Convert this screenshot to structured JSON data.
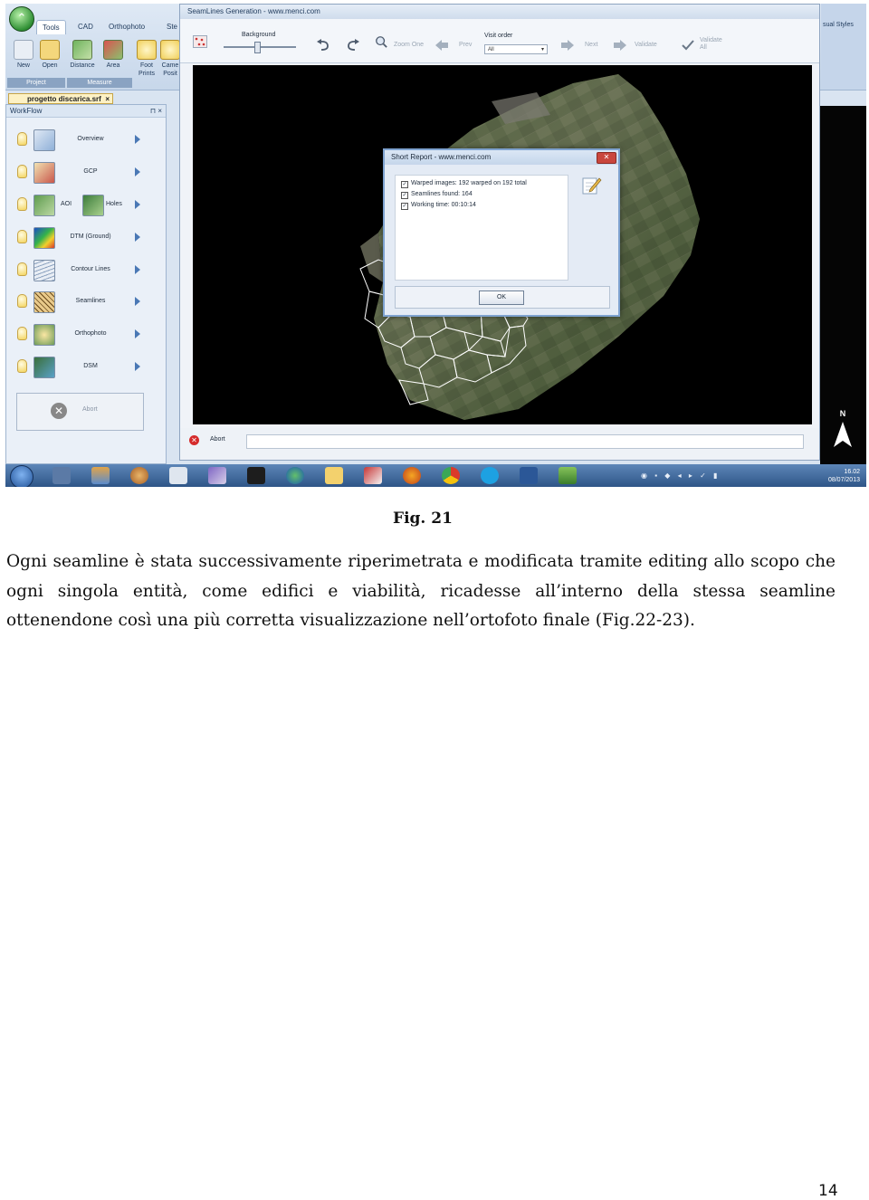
{
  "ribbon": {
    "tabs": [
      "Tools",
      "CAD",
      "Orthophoto",
      "Ste"
    ],
    "buttons": [
      "New",
      "Open",
      "Distance",
      "Area",
      "Foot Prints",
      "Came Posit"
    ],
    "groups": [
      "Project",
      "Measure"
    ],
    "right_label": "sual Styles"
  },
  "project_tab": {
    "label": "progetto discarica.srf",
    "close": "×"
  },
  "workflow": {
    "title": "WorkFlow",
    "controls": "⊓ ×",
    "items": [
      {
        "label": "Overview"
      },
      {
        "label": "GCP"
      },
      {
        "label": "AOI",
        "label2": "Holes"
      },
      {
        "label": "DTM (Ground)"
      },
      {
        "label": "Contour Lines"
      },
      {
        "label": "Seamlines"
      },
      {
        "label": "Orthophoto"
      },
      {
        "label": "DSM"
      }
    ],
    "abort_label": "Abort"
  },
  "seamlines_window": {
    "title": "SeamLines Generation - www.menci.com",
    "toolbar": {
      "background_label": "Background",
      "zoom_one": "Zoom One",
      "prev": "Prev",
      "visit_order_label": "Visit order",
      "visit_order_value": "All",
      "next": "Next",
      "validate": "Validate",
      "validate_all": "Validate All"
    },
    "status_abort": "Abort"
  },
  "dialog": {
    "title": "Short Report - www.menci.com",
    "close": "✕",
    "lines": [
      "Warped images: 192 warped on 192 total",
      "Seamlines found: 164",
      "Working time: 00:10:14"
    ],
    "ok": "OK"
  },
  "north_label": "N",
  "clock": {
    "time": "16.02",
    "date": "08/07/2013"
  },
  "caption": "Fig. 21",
  "paragraph": "Ogni seamline  è stata successivamente riperimetrata e modificata tramite editing allo scopo che ogni singola entità, come edifici e viabilità, ricadesse all’interno della stessa seamline  ottenendone così una più corretta visualizzazione nell’ortofoto finale (Fig.22-23).",
  "page_number": "14"
}
